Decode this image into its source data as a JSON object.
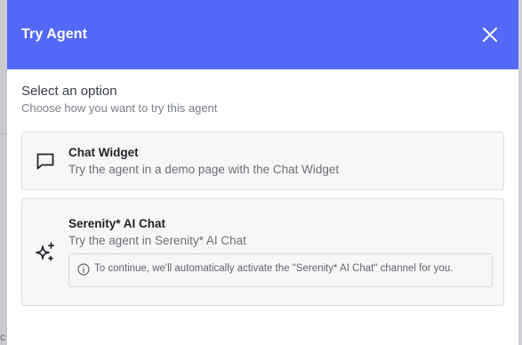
{
  "dialog": {
    "title": "Try Agent",
    "close_icon": "close-icon",
    "header_color": "#5468f8"
  },
  "section": {
    "title": "Select an option",
    "subtitle": "Choose how you want to try this agent"
  },
  "options": [
    {
      "icon": "chat-bubble-icon",
      "title": "Chat Widget",
      "description": "Try the agent in a demo page with the Chat Widget"
    },
    {
      "icon": "sparkles-icon",
      "title": "Serenity* AI Chat",
      "description": "Try the agent in Serenity* AI Chat",
      "info_icon": "info-icon",
      "info": "To continue, we'll automatically activate the \"Serenity* AI Chat\" channel for you."
    }
  ]
}
